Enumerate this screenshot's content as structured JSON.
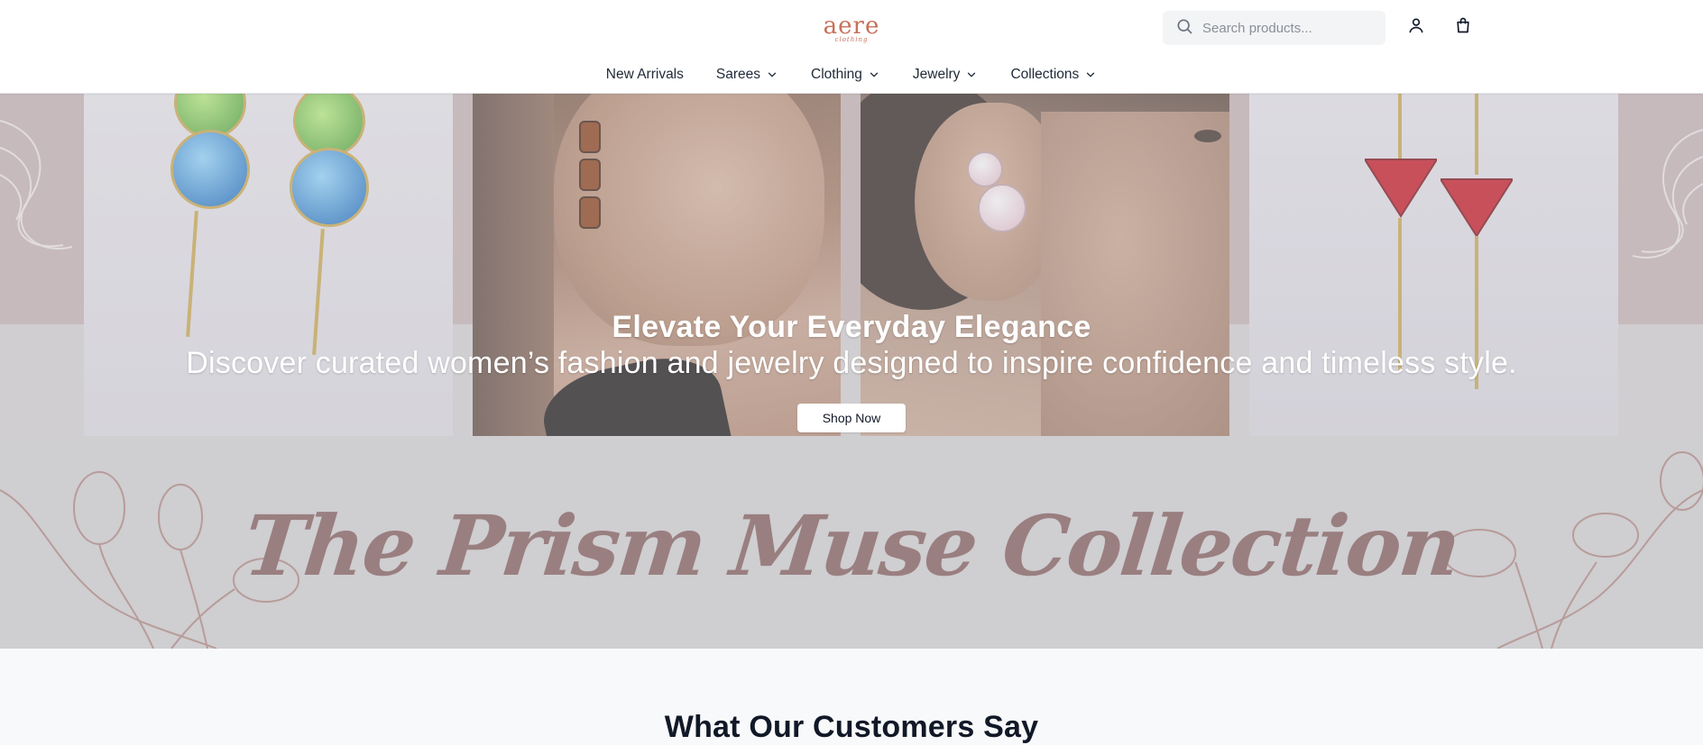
{
  "brand": {
    "logo_word": "aere",
    "logo_sub": "clothing",
    "accent": "#c8705a"
  },
  "search": {
    "placeholder": "Search products..."
  },
  "header_icons": {
    "account": "user-icon",
    "cart": "shopping-bag-icon",
    "search": "search-icon"
  },
  "nav": {
    "items": [
      {
        "label": "New Arrivals",
        "has_dropdown": false
      },
      {
        "label": "Sarees",
        "has_dropdown": true
      },
      {
        "label": "Clothing",
        "has_dropdown": true
      },
      {
        "label": "Jewelry",
        "has_dropdown": true
      },
      {
        "label": "Collections",
        "has_dropdown": true
      }
    ]
  },
  "hero": {
    "title": "Elevate Your Everyday Elegance",
    "subtitle": "Discover curated women’s fashion and jewelry designed to inspire confidence and timeless style.",
    "cta_label": "Shop Now",
    "collection_title": "The Prism Muse Collection",
    "colors": {
      "mauve": "#c7b3b2",
      "collection_text": "#9a7f80"
    }
  },
  "testimonials": {
    "heading": "What Our Customers Say"
  }
}
